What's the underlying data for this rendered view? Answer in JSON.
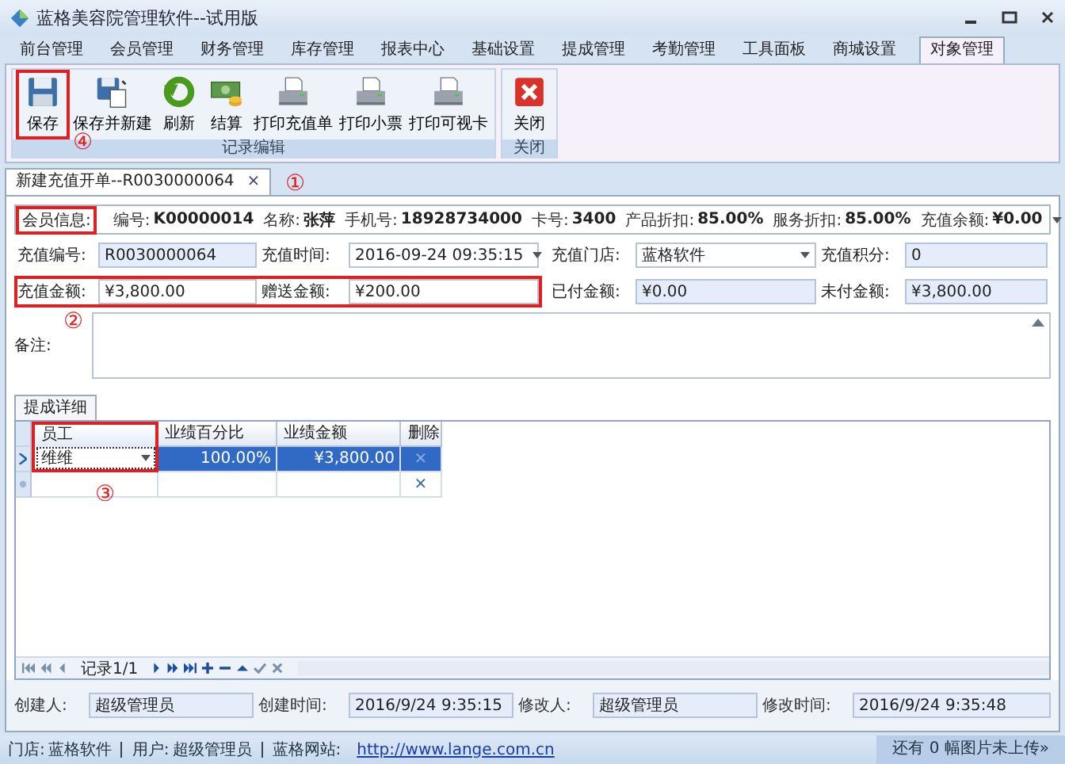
{
  "window": {
    "title": "蓝格美容院管理软件--试用版"
  },
  "menu_tabs": [
    {
      "label": "前台管理",
      "selected": false
    },
    {
      "label": "会员管理",
      "selected": false
    },
    {
      "label": "财务管理",
      "selected": false
    },
    {
      "label": "库存管理",
      "selected": false
    },
    {
      "label": "报表中心",
      "selected": false
    },
    {
      "label": "基础设置",
      "selected": false
    },
    {
      "label": "提成管理",
      "selected": false
    },
    {
      "label": "考勤管理",
      "selected": false
    },
    {
      "label": "工具面板",
      "selected": false
    },
    {
      "label": "商城设置",
      "selected": false
    },
    {
      "label": "对象管理",
      "selected": true
    }
  ],
  "ribbon_groups": [
    {
      "title": "记录编辑",
      "buttons": [
        {
          "label": "保存",
          "kind": "save"
        },
        {
          "label": "保存并新建",
          "kind": "save-new"
        },
        {
          "label": "刷新",
          "kind": "refresh"
        },
        {
          "label": "结算",
          "kind": "money"
        },
        {
          "label": "打印充值单",
          "kind": "print"
        },
        {
          "label": "打印小票",
          "kind": "print"
        },
        {
          "label": "打印可视卡",
          "kind": "print"
        }
      ]
    },
    {
      "title": "关闭",
      "buttons": [
        {
          "label": "关闭",
          "kind": "close"
        }
      ]
    }
  ],
  "document_tab": {
    "title": "新建充值开单--R0030000064",
    "close": "×"
  },
  "member_info": {
    "label": "会员信息:",
    "items": [
      {
        "label": "编号:",
        "value": "K00000014"
      },
      {
        "label": "名称:",
        "value": "张萍"
      },
      {
        "label": "手机号:",
        "value": "18928734000"
      },
      {
        "label": "卡号:",
        "value": "3400"
      },
      {
        "label": "产品折扣:",
        "value": "85.00%"
      },
      {
        "label": "服务折扣:",
        "value": "85.00%"
      },
      {
        "label": "充值余额:",
        "value": "¥0.00"
      }
    ]
  },
  "form_rows": [
    [
      {
        "label": "充值编号:",
        "value": "R0030000064",
        "kind": "readonly"
      },
      {
        "label": "充值时间:",
        "value": "2016-09-24 09:35:15",
        "kind": "dropdown"
      },
      {
        "label": "充值门店:",
        "value": "蓝格软件",
        "kind": "dropdown"
      },
      {
        "label": "充值积分:",
        "value": "0",
        "kind": "readonly"
      }
    ],
    [
      {
        "label": "充值金额:",
        "value": "¥3,800.00",
        "kind": "input"
      },
      {
        "label": "赠送金额:",
        "value": "¥200.00",
        "kind": "input"
      },
      {
        "label": "已付金额:",
        "value": "¥0.00",
        "kind": "readonly"
      },
      {
        "label": "未付金额:",
        "value": "¥3,800.00",
        "kind": "readonly"
      }
    ]
  ],
  "remarks": {
    "label": "备注:"
  },
  "detail_tab": {
    "title": "提成详细"
  },
  "grid": {
    "columns": [
      "员工",
      "业绩百分比",
      "业绩金额",
      "删除"
    ],
    "rows": [
      {
        "employee": "维维",
        "percent": "100.00%",
        "amount": "¥3,800.00",
        "delete": "×",
        "selected": true
      }
    ],
    "new_row": {
      "delete": "×"
    }
  },
  "navigator": {
    "record": "记录1/1"
  },
  "footer": [
    {
      "label": "创建人:",
      "value": "超级管理员"
    },
    {
      "label": "创建时间:",
      "value": "2016/9/24 9:35:15"
    },
    {
      "label": "修改人:",
      "value": "超级管理员"
    },
    {
      "label": "修改时间:",
      "value": "2016/9/24 9:35:48"
    }
  ],
  "status_bar": {
    "items": [
      {
        "label": "门店:",
        "value": "蓝格软件"
      },
      {
        "label": "用户:",
        "value": "超级管理员"
      },
      {
        "label": "蓝格网站:",
        "value": "http://www.lange.com.cn",
        "kind": "link"
      }
    ],
    "right": "还有 0 幅图片未上传»"
  },
  "annotations": [
    "①",
    "②",
    "③",
    "④"
  ]
}
